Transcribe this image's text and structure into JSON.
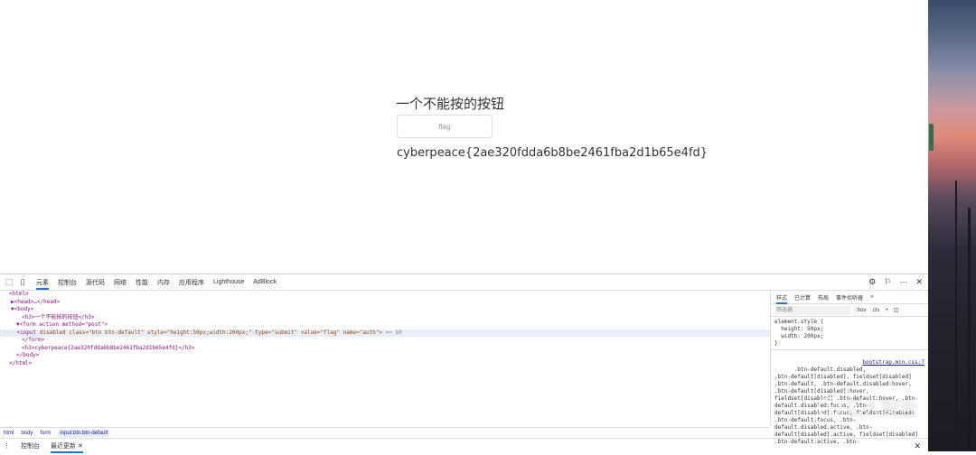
{
  "page": {
    "heading": "一个不能按的按钮",
    "button_label": "flag",
    "flag_text": "cyberpeace{2ae320fdda6b8be2461fba2d1b65e4fd}"
  },
  "devtools": {
    "tabs": [
      "元素",
      "控制台",
      "源代码",
      "网络",
      "性能",
      "内存",
      "应用程序",
      "Lighthouse",
      "AdBlock"
    ],
    "active_tab": "元素",
    "dom_lines": {
      "l1": "<html>",
      "l2": "▶<head>…</head>",
      "l3": "▼<body>",
      "l4": "<h3>一个不能按的按钮</h3>",
      "l5": "▼<form action method=\"post\">",
      "l6_tag_open": "<input",
      "l6_attrs": " disabled class=\"btn btn-default\" style=\"height:50px;width:200px;\" type=\"submit\" value=\"flag\" name=\"auth\">",
      "l6_eq": " == $0",
      "l7": "</form>",
      "l8": "<h3>cyberpeace{2ae320fdda6b8be2461fba2d1b65e4fd}</h3>",
      "l9": "</body>",
      "l10": "</html>"
    },
    "breadcrumbs": [
      "html",
      "body",
      "form",
      "input.btn.btn-default"
    ],
    "drawer_tabs": [
      "控制台",
      "最近更新"
    ],
    "styles_tabs": [
      "样式",
      "已计算",
      "布局",
      "事件侦听器"
    ],
    "filter_placeholder": "筛选器",
    "filter_hov": ":hov",
    "filter_cls": ".cls",
    "element_style": "element.style {\n  height: 50px;\n  width: 200px;\n}",
    "rule_source": "bootstrap.min.css:7",
    "rule_selectors": ".btn-default.disabled,\n.btn-default[disabled], fieldset[disabled]\n.btn-default, .btn-default.disabled:hover,\n.btn-default[disabled]:hover,\nfieldset[disabled] .btn-default:hover, .btn-\ndefault.disabled:focus, .btn-\ndefault[disabled]:focus, fieldset[disabled]\n.btn-default:focus, .btn-\ndefault.disabled.active, .btn-\ndefault[disabled].active, fieldset[disabled]\n.btn-default:active, .btn-"
  },
  "watermark": "亿人安全"
}
